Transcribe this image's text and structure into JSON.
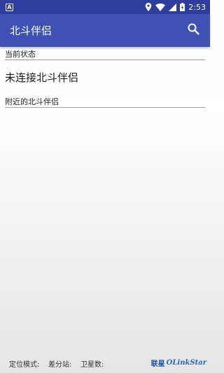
{
  "status_bar": {
    "notification_letter": "A",
    "time": "2:53",
    "icons": [
      "location-icon",
      "wifi-icon",
      "signal-icon",
      "battery-charging-icon"
    ]
  },
  "app_bar": {
    "title": "北斗伴侣",
    "search_icon": "search-icon",
    "background": "#3f51b5"
  },
  "sections": {
    "current_status_header": "当前状态",
    "current_status_value": "未连接北斗伴侣",
    "nearby_header": "附近的北斗伴侣"
  },
  "footer": {
    "positioning_mode_label": "定位模式:",
    "diff_station_label": "差分站:",
    "satellite_count_label": "卫星数:",
    "logo_cn": "联星",
    "logo_en": "OLinkStar"
  }
}
